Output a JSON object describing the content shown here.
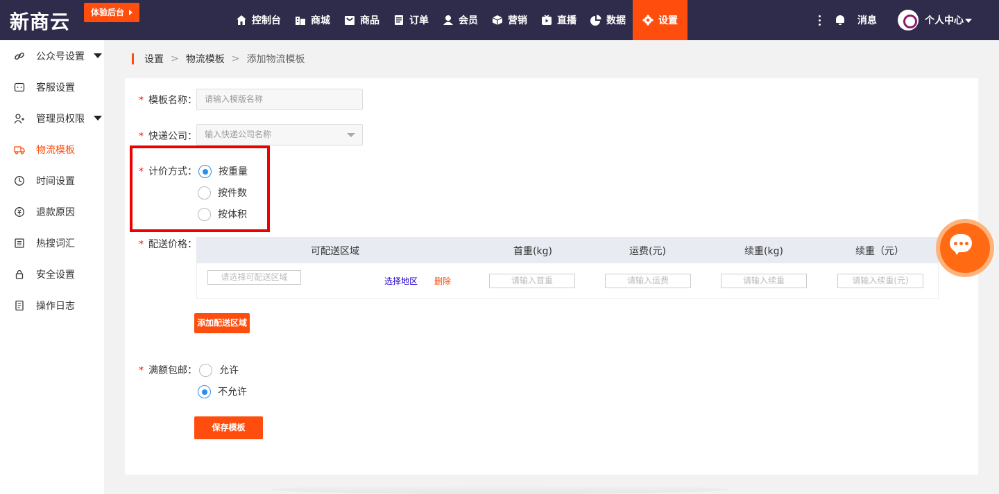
{
  "header": {
    "logo": "新商云",
    "trial_button": "体验后台",
    "nav": [
      {
        "label": "控制台",
        "icon": "home-icon"
      },
      {
        "label": "商城",
        "icon": "store-icon"
      },
      {
        "label": "商品",
        "icon": "bag-icon"
      },
      {
        "label": "订单",
        "icon": "order-icon"
      },
      {
        "label": "会员",
        "icon": "user-icon"
      },
      {
        "label": "营销",
        "icon": "box-icon"
      },
      {
        "label": "直播",
        "icon": "live-icon"
      },
      {
        "label": "数据",
        "icon": "pie-chart-icon"
      },
      {
        "label": "设置",
        "icon": "gear-icon",
        "active": true
      }
    ],
    "messages": "消息",
    "user_center": "个人中心"
  },
  "sidebar": {
    "items": [
      {
        "label": "公众号设置",
        "icon": "link-icon",
        "expandable": true
      },
      {
        "label": "客服设置",
        "icon": "chat-icon"
      },
      {
        "label": "管理员权限",
        "icon": "admin-icon",
        "expandable": true
      },
      {
        "label": "物流模板",
        "icon": "truck-icon",
        "active": true
      },
      {
        "label": "时间设置",
        "icon": "clock-icon"
      },
      {
        "label": "退款原因",
        "icon": "refund-icon"
      },
      {
        "label": "热搜词汇",
        "icon": "list-icon"
      },
      {
        "label": "安全设置",
        "icon": "lock-icon"
      },
      {
        "label": "操作日志",
        "icon": "log-icon"
      }
    ]
  },
  "breadcrumb": [
    "设置",
    "物流模板",
    "添加物流模板"
  ],
  "form": {
    "required_mark": "*",
    "template_name": {
      "label": "模板名称：",
      "placeholder": "请输入模版名称"
    },
    "courier": {
      "label": "快递公司：",
      "placeholder": "输入快递公司名称"
    },
    "pricing": {
      "label": "计价方式：",
      "options": [
        "按重量",
        "按件数",
        "按体积"
      ],
      "selected": "按重量"
    },
    "delivery": {
      "label": "配送价格：",
      "columns": [
        "可配送区域",
        "首重(kg)",
        "运费(元)",
        "续重(kg)",
        "续重（元）"
      ],
      "row": {
        "region_placeholder": "请选择可配送区域",
        "select_region": "选择地区",
        "delete": "删除",
        "first_weight_placeholder": "请输入首重",
        "freight_placeholder": "请输入运费",
        "extra_weight_placeholder": "请输入续重",
        "extra_fee_placeholder": "请输入续重(元)"
      },
      "add_button": "添加配送区域"
    },
    "free_shipping": {
      "label": "满额包邮：",
      "options": [
        "允许",
        "不允许"
      ],
      "selected": "不允许"
    },
    "save_button": "保存模板"
  },
  "colors": {
    "accent": "#ff4d0d",
    "nav_bg": "#2f2b4a",
    "radio": "#2e8ded",
    "link": "#2200cc"
  }
}
